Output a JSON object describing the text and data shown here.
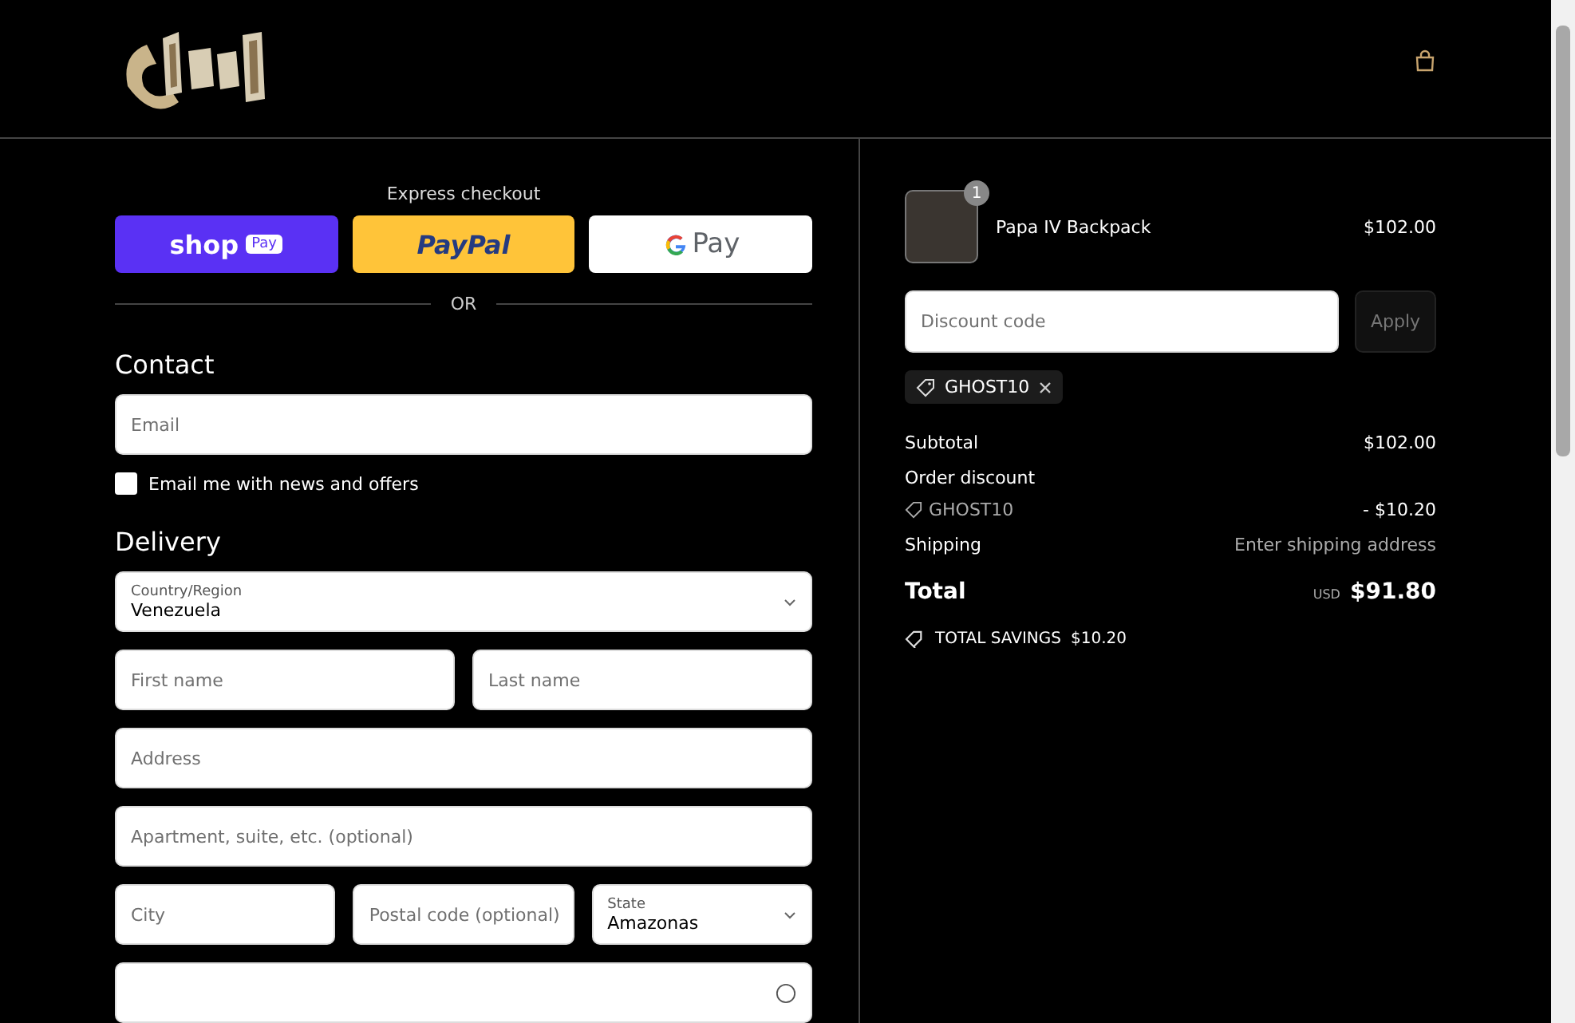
{
  "express": {
    "title": "Express checkout",
    "buttons": [
      {
        "kind": "shop",
        "label": "shop",
        "tag": "Pay"
      },
      {
        "kind": "paypal",
        "label": "PayPal"
      },
      {
        "kind": "gpay",
        "label": "Pay"
      }
    ],
    "divider": "OR"
  },
  "contact": {
    "heading": "Contact",
    "email": {
      "placeholder": "Email"
    },
    "newsletter": {
      "label": "Email me with news and offers",
      "checked": false
    }
  },
  "delivery": {
    "heading": "Delivery",
    "rows": [
      [
        {
          "kind": "select",
          "label": "Country/Region",
          "value": "Venezuela"
        }
      ],
      [
        {
          "kind": "text",
          "placeholder": "First name"
        },
        {
          "kind": "text",
          "placeholder": "Last name"
        }
      ],
      [
        {
          "kind": "text",
          "placeholder": "Address"
        }
      ],
      [
        {
          "kind": "text",
          "placeholder": "Apartment, suite, etc. (optional)"
        }
      ],
      [
        {
          "kind": "text",
          "placeholder": "City"
        },
        {
          "kind": "text",
          "placeholder": "Postal code (optional)"
        },
        {
          "kind": "select",
          "label": "State",
          "value": "Amazonas"
        }
      ],
      [
        {
          "kind": "help"
        }
      ]
    ]
  },
  "summary": {
    "item": {
      "quantity": "1",
      "name": "Papa IV Backpack",
      "price": "$102.00"
    },
    "discount": {
      "placeholder": "Discount code",
      "button": "Apply",
      "tag": "GHOST10"
    },
    "lines": [
      {
        "kind": "plain",
        "label": "Subtotal",
        "value": "$102.00"
      },
      {
        "kind": "head",
        "label": "Order discount"
      },
      {
        "kind": "code",
        "label": "GHOST10",
        "value": "- $10.20"
      },
      {
        "kind": "muted",
        "label": "Shipping",
        "value": "Enter shipping address"
      }
    ],
    "total": {
      "label": "Total",
      "currency": "USD",
      "value": "$91.80"
    },
    "savings": {
      "label": "TOTAL SAVINGS",
      "value": "$10.20"
    }
  }
}
